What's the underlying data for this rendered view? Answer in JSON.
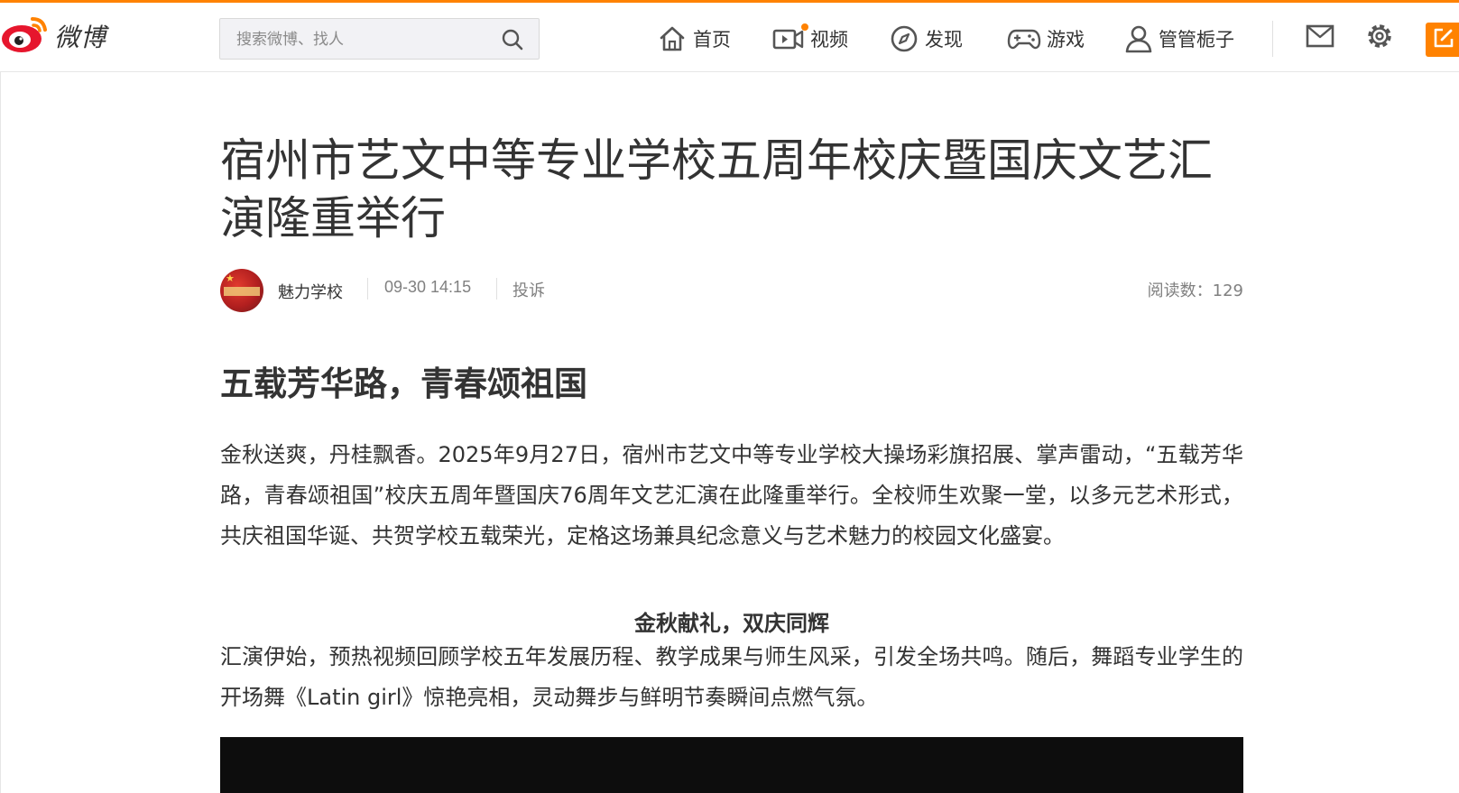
{
  "colors": {
    "accent": "#ff8200",
    "weibo_red": "#e6162d",
    "text": "#333333",
    "muted": "#808080"
  },
  "header": {
    "logo_text": "微博",
    "search_placeholder": "搜索微博、找人",
    "nav": {
      "home": "首页",
      "video": "视频",
      "discover": "发现",
      "game": "游戏",
      "profile": "管管栀子"
    },
    "icons": [
      "weibo-logo-icon",
      "search-icon",
      "home-icon",
      "video-icon",
      "compass-icon",
      "gamepad-icon",
      "user-icon",
      "mail-icon",
      "gear-icon",
      "compose-icon"
    ]
  },
  "article": {
    "title": "宿州市艺文中等专业学校五周年校庆暨国庆文艺汇演隆重举行",
    "author": "魅力学校",
    "time": "09-30 14:15",
    "report": "投诉",
    "reads": "阅读数：129",
    "section_heading": "五载芳华路，青春颂祖国",
    "paragraph1": "金秋送爽，丹桂飘香。2025年9月27日，宿州市艺文中等专业学校大操场彩旗招展、掌声雷动，“五载芳华路，青春颂祖国”校庆五周年暨国庆76周年文艺汇演在此隆重举行。全校师生欢聚一堂，以多元艺术形式，共庆祖国华诞、共贺学校五载荣光，定格这场兼具纪念意义与艺术魅力的校园文化盛宴。",
    "subheading": "金秋献礼，双庆同辉",
    "paragraph2": "汇演伊始，预热视频回顾学校五年发展历程、教学成果与师生风采，引发全场共鸣。随后，舞蹈专业学生的开场舞《Latin girl》惊艳亮相，灵动舞步与鲜明节奏瞬间点燃气氛。"
  }
}
